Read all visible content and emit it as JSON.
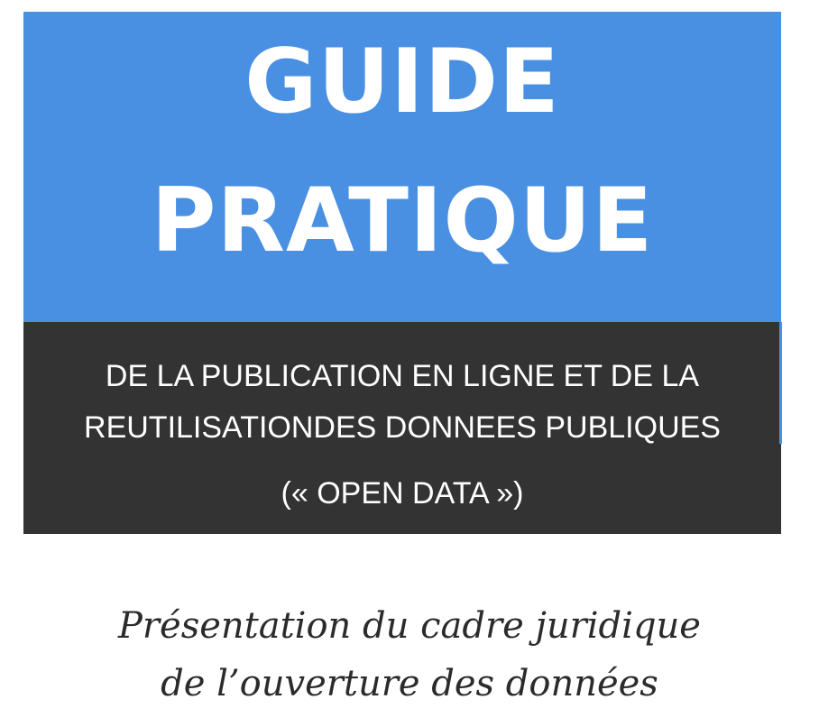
{
  "cover": {
    "title_line1": "GUIDE",
    "title_line2": "PRATIQUE",
    "subtitle_line1": "DE LA PUBLICATION EN LIGNE ET DE LA",
    "subtitle_line2": "REUTILISATIONDES DONNEES PUBLIQUES",
    "subtitle_line3": "(« OPEN DATA »)",
    "presentation_line1": "Présentation du cadre juridique",
    "presentation_line2": "de l’ouverture des données"
  },
  "colors": {
    "title_band": "#4a90e2",
    "subtitle_band": "#333333",
    "title_text": "#ffffff",
    "body_text": "#2b2b2b"
  }
}
